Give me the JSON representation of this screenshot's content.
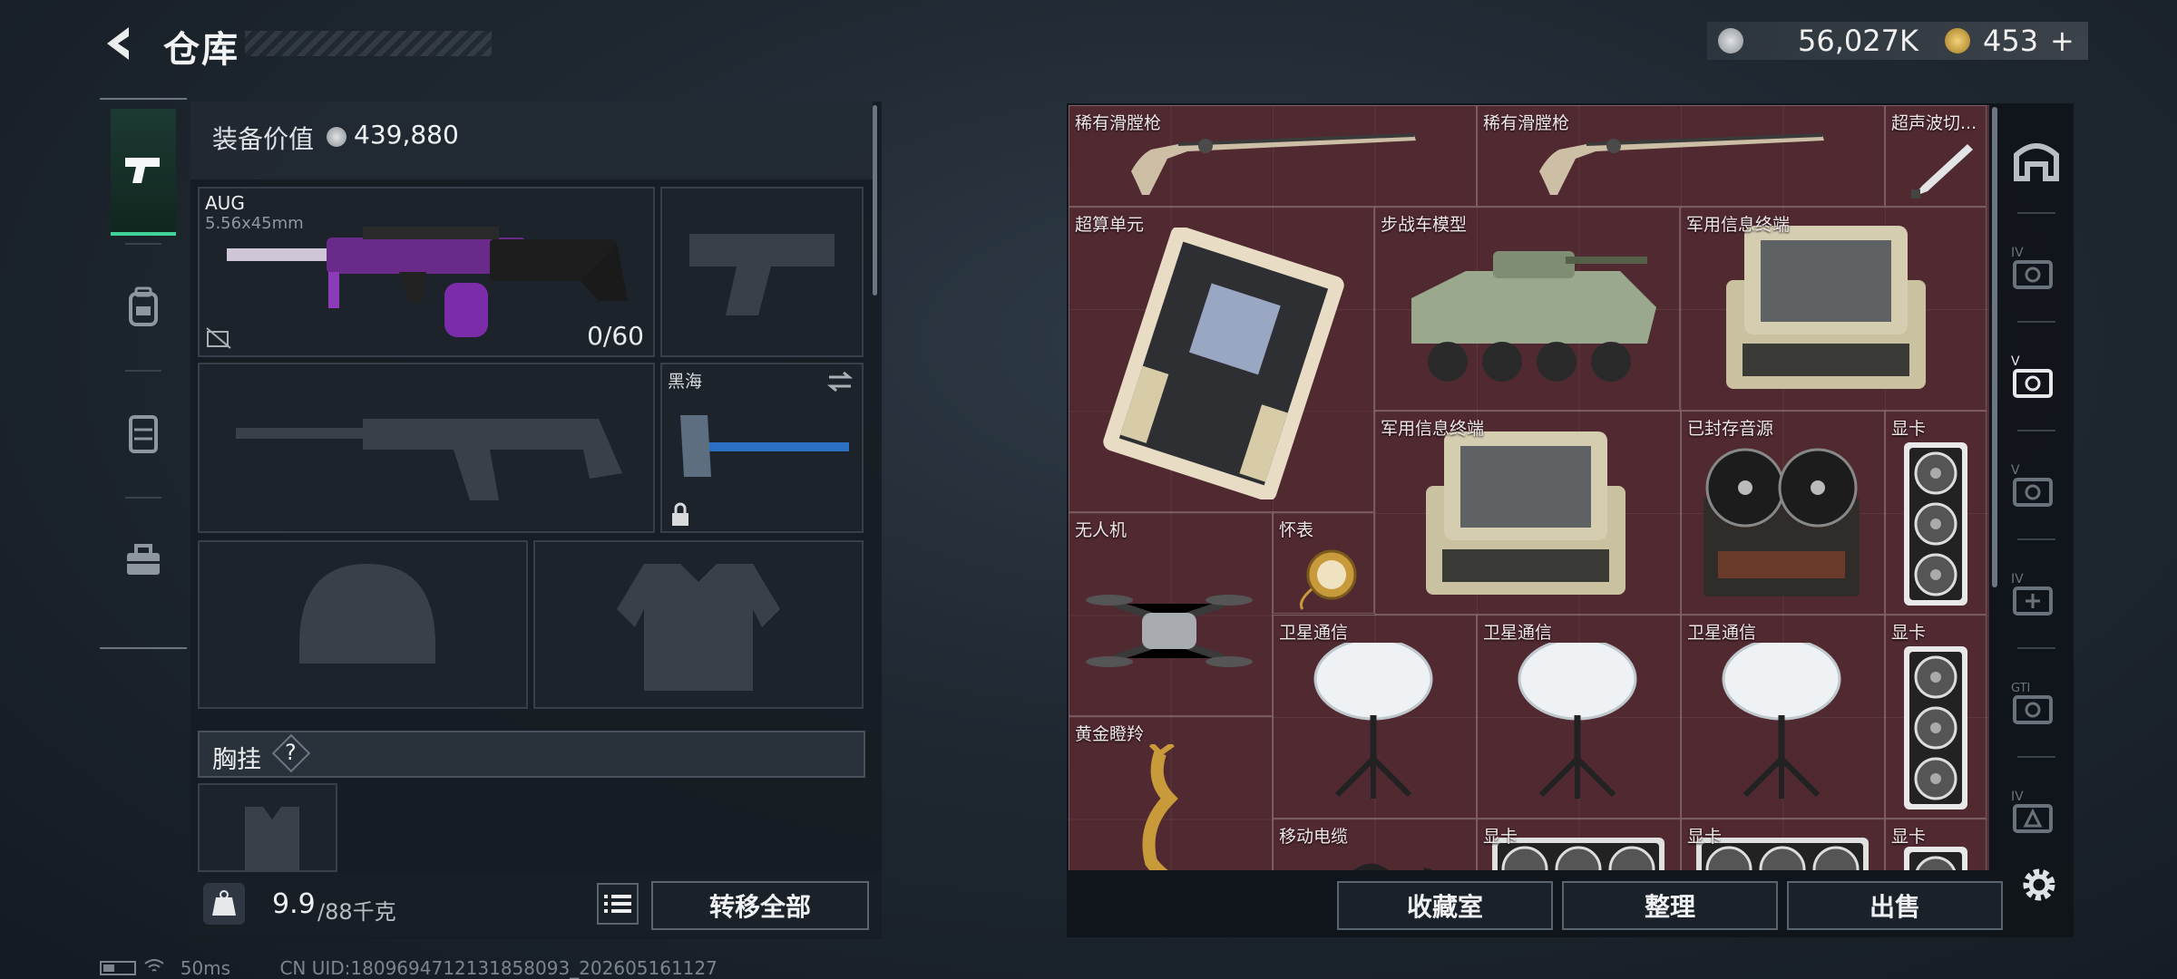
{
  "header": {
    "title": "仓库"
  },
  "currency": {
    "silver": "56,027K",
    "gold": "453",
    "add": "+"
  },
  "equipment": {
    "value_label": "装备价值",
    "value": "439,880",
    "primary_weapon": {
      "name": "AUG",
      "caliber": "5.56x45mm",
      "ammo": "0/60"
    },
    "melee": {
      "name": "黑海"
    },
    "chest_rig_label": "胸挂",
    "chest_rig_help": "?"
  },
  "inventory": {
    "weight": "9.9",
    "capacity": "/88千克",
    "transfer_all": "转移全部",
    "kg_icon_text": "KG"
  },
  "stash": {
    "items": [
      {
        "label": "稀有滑膛枪",
        "icon": "musket"
      },
      {
        "label": "稀有滑膛枪",
        "icon": "musket"
      },
      {
        "label": "超声波切...",
        "icon": "scalpel"
      },
      {
        "label": "超算单元",
        "icon": "circuit-board"
      },
      {
        "label": "步战车模型",
        "icon": "ifv-model"
      },
      {
        "label": "军用信息终端",
        "icon": "field-terminal"
      },
      {
        "label": "军用信息终端",
        "icon": "field-terminal"
      },
      {
        "label": "已封存音源",
        "icon": "tape-recorder"
      },
      {
        "label": "显卡",
        "icon": "gpu"
      },
      {
        "label": "无人机",
        "icon": "drone"
      },
      {
        "label": "怀表",
        "icon": "pocket-watch"
      },
      {
        "label": "卫星通信",
        "icon": "satellite-dish"
      },
      {
        "label": "卫星通信",
        "icon": "satellite-dish"
      },
      {
        "label": "卫星通信",
        "icon": "satellite-dish"
      },
      {
        "label": "显卡",
        "icon": "gpu"
      },
      {
        "label": "黄金瞪羚",
        "icon": "gold-gazelle"
      },
      {
        "label": "移动电缆",
        "icon": "cable"
      },
      {
        "label": "显卡",
        "icon": "gpu"
      },
      {
        "label": "显卡",
        "icon": "gpu"
      },
      {
        "label": "显卡",
        "icon": "gpu"
      }
    ],
    "buttons": {
      "collection": "收藏室",
      "organize": "整理",
      "sell": "出售"
    },
    "tabs": [
      {
        "icon": "stash-home-icon"
      },
      {
        "label": "IV",
        "icon": "camera-level-4-icon"
      },
      {
        "label": "V",
        "icon": "camera-level-5-icon"
      },
      {
        "label": "V",
        "icon": "camera-level-5-icon"
      },
      {
        "label": "IV",
        "icon": "camera-add-icon"
      },
      {
        "label": "GTI",
        "icon": "camera-gti-icon"
      },
      {
        "label": "IV",
        "icon": "camera-warning-icon"
      }
    ]
  },
  "status": {
    "ping": "50ms",
    "uid": "CN UID:1809694712131858093_202605161127"
  }
}
